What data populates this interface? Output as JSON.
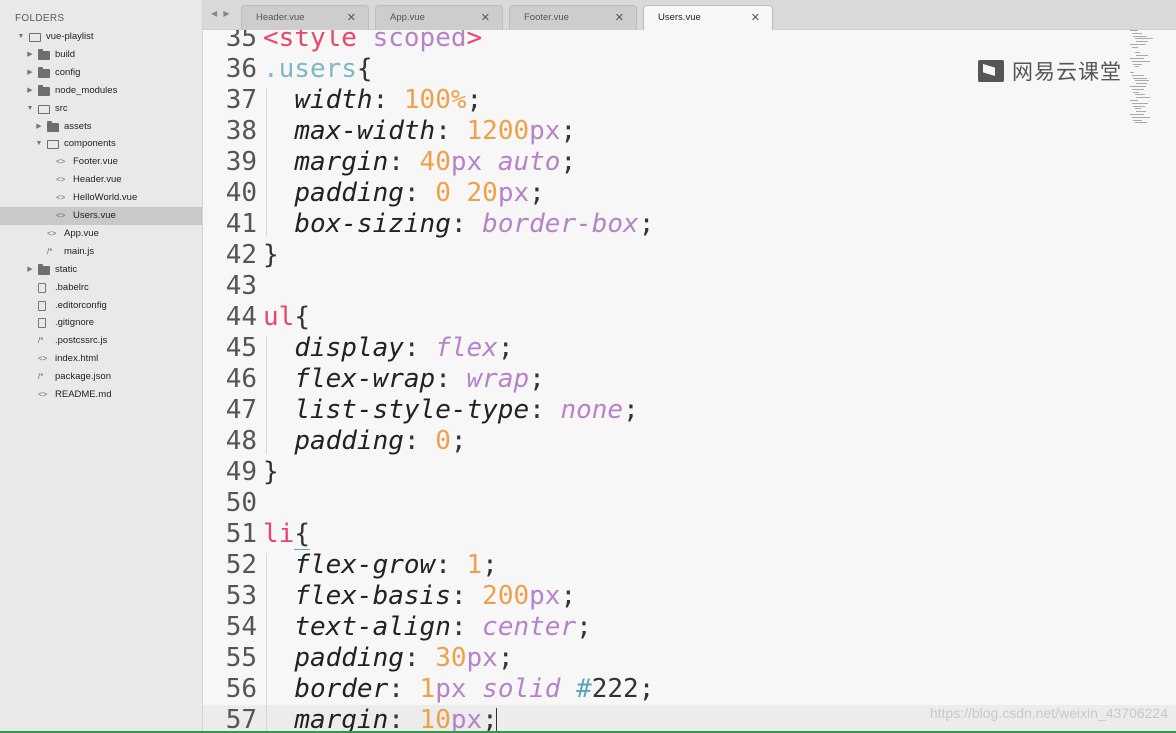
{
  "sidebar": {
    "header": "FOLDERS",
    "items": [
      {
        "label": "vue-playlist",
        "kind": "folder-open",
        "arrow": "▼"
      },
      {
        "label": "build",
        "kind": "folder",
        "arrow": "▶"
      },
      {
        "label": "config",
        "kind": "folder",
        "arrow": "▶"
      },
      {
        "label": "node_modules",
        "kind": "folder",
        "arrow": "▶"
      },
      {
        "label": "src",
        "kind": "folder-open",
        "arrow": "▼"
      },
      {
        "label": "assets",
        "kind": "folder",
        "arrow": "▶"
      },
      {
        "label": "components",
        "kind": "folder-open",
        "arrow": "▼"
      },
      {
        "label": "Footer.vue",
        "kind": "code",
        "icon": "<>"
      },
      {
        "label": "Header.vue",
        "kind": "code",
        "icon": "<>"
      },
      {
        "label": "HelloWorld.vue",
        "kind": "code",
        "icon": "<>"
      },
      {
        "label": "Users.vue",
        "kind": "code",
        "icon": "<>",
        "selected": true
      },
      {
        "label": "App.vue",
        "kind": "code",
        "icon": "<>"
      },
      {
        "label": "main.js",
        "kind": "js",
        "icon": "/*"
      },
      {
        "label": "static",
        "kind": "folder",
        "arrow": "▶"
      },
      {
        "label": ".babelrc",
        "kind": "file"
      },
      {
        "label": ".editorconfig",
        "kind": "file"
      },
      {
        "label": ".gitignore",
        "kind": "file"
      },
      {
        "label": ".postcssrc.js",
        "kind": "js",
        "icon": "/*"
      },
      {
        "label": "index.html",
        "kind": "code",
        "icon": "<>"
      },
      {
        "label": "package.json",
        "kind": "js",
        "icon": "/*"
      },
      {
        "label": "README.md",
        "kind": "code",
        "icon": "<>"
      }
    ]
  },
  "tabs": {
    "nav": "◀ ▶",
    "items": [
      {
        "label": "Header.vue",
        "close": "✕",
        "active": false
      },
      {
        "label": "App.vue",
        "close": "✕",
        "active": false
      },
      {
        "label": "Footer.vue",
        "close": "✕",
        "active": false
      },
      {
        "label": "Users.vue",
        "close": "✕",
        "active": true
      }
    ]
  },
  "editor": {
    "current_line": 57,
    "lines": [
      {
        "n": "35",
        "tokens": [
          [
            "t-tag",
            "<style "
          ],
          [
            "t-attr",
            "scoped"
          ],
          [
            "t-tag",
            ">"
          ]
        ]
      },
      {
        "n": "36",
        "tokens": [
          [
            "t-sel",
            ".users"
          ],
          [
            "t-brace",
            "{"
          ]
        ]
      },
      {
        "n": "37",
        "tokens": [
          [
            "t-str",
            "  "
          ],
          [
            "t-prop",
            "width"
          ],
          [
            "t-punc",
            ": "
          ],
          [
            "t-num",
            "100%"
          ],
          [
            "t-punc",
            ";"
          ]
        ]
      },
      {
        "n": "38",
        "tokens": [
          [
            "t-str",
            "  "
          ],
          [
            "t-prop",
            "max-width"
          ],
          [
            "t-punc",
            ": "
          ],
          [
            "t-num",
            "1200"
          ],
          [
            "t-unit",
            "px"
          ],
          [
            "t-punc",
            ";"
          ]
        ]
      },
      {
        "n": "39",
        "tokens": [
          [
            "t-str",
            "  "
          ],
          [
            "t-prop",
            "margin"
          ],
          [
            "t-punc",
            ": "
          ],
          [
            "t-num",
            "40"
          ],
          [
            "t-unit",
            "px "
          ],
          [
            "t-kw",
            "auto"
          ],
          [
            "t-punc",
            ";"
          ]
        ]
      },
      {
        "n": "40",
        "tokens": [
          [
            "t-str",
            "  "
          ],
          [
            "t-prop",
            "padding"
          ],
          [
            "t-punc",
            ": "
          ],
          [
            "t-num",
            "0 20"
          ],
          [
            "t-unit",
            "px"
          ],
          [
            "t-punc",
            ";"
          ]
        ]
      },
      {
        "n": "41",
        "tokens": [
          [
            "t-str",
            "  "
          ],
          [
            "t-prop",
            "box-sizing"
          ],
          [
            "t-punc",
            ": "
          ],
          [
            "t-kw",
            "border-box"
          ],
          [
            "t-punc",
            ";"
          ]
        ]
      },
      {
        "n": "42",
        "tokens": [
          [
            "t-brace",
            "}"
          ]
        ]
      },
      {
        "n": "43",
        "tokens": []
      },
      {
        "n": "44",
        "tokens": [
          [
            "t-selred",
            "ul"
          ],
          [
            "t-brace",
            "{"
          ]
        ]
      },
      {
        "n": "45",
        "tokens": [
          [
            "t-str",
            "  "
          ],
          [
            "t-prop",
            "display"
          ],
          [
            "t-punc",
            ": "
          ],
          [
            "t-kw",
            "flex"
          ],
          [
            "t-punc",
            ";"
          ]
        ]
      },
      {
        "n": "46",
        "tokens": [
          [
            "t-str",
            "  "
          ],
          [
            "t-prop",
            "flex-wrap"
          ],
          [
            "t-punc",
            ": "
          ],
          [
            "t-kw",
            "wrap"
          ],
          [
            "t-punc",
            ";"
          ]
        ]
      },
      {
        "n": "47",
        "tokens": [
          [
            "t-str",
            "  "
          ],
          [
            "t-prop",
            "list-style-type"
          ],
          [
            "t-punc",
            ": "
          ],
          [
            "t-kw",
            "none"
          ],
          [
            "t-punc",
            ";"
          ]
        ]
      },
      {
        "n": "48",
        "tokens": [
          [
            "t-str",
            "  "
          ],
          [
            "t-prop",
            "padding"
          ],
          [
            "t-punc",
            ": "
          ],
          [
            "t-num",
            "0"
          ],
          [
            "t-punc",
            ";"
          ]
        ]
      },
      {
        "n": "49",
        "tokens": [
          [
            "t-brace",
            "}"
          ]
        ]
      },
      {
        "n": "50",
        "tokens": []
      },
      {
        "n": "51",
        "tokens": [
          [
            "t-selred",
            "li"
          ],
          [
            "t-brace",
            "{"
          ]
        ]
      },
      {
        "n": "52",
        "tokens": [
          [
            "t-str",
            "  "
          ],
          [
            "t-prop",
            "flex-grow"
          ],
          [
            "t-punc",
            ": "
          ],
          [
            "t-num",
            "1"
          ],
          [
            "t-punc",
            ";"
          ]
        ]
      },
      {
        "n": "53",
        "tokens": [
          [
            "t-str",
            "  "
          ],
          [
            "t-prop",
            "flex-basis"
          ],
          [
            "t-punc",
            ": "
          ],
          [
            "t-num",
            "200"
          ],
          [
            "t-unit",
            "px"
          ],
          [
            "t-punc",
            ";"
          ]
        ]
      },
      {
        "n": "54",
        "tokens": [
          [
            "t-str",
            "  "
          ],
          [
            "t-prop",
            "text-align"
          ],
          [
            "t-punc",
            ": "
          ],
          [
            "t-kw",
            "center"
          ],
          [
            "t-punc",
            ";"
          ]
        ]
      },
      {
        "n": "55",
        "tokens": [
          [
            "t-str",
            "  "
          ],
          [
            "t-prop",
            "padding"
          ],
          [
            "t-punc",
            ": "
          ],
          [
            "t-num",
            "30"
          ],
          [
            "t-unit",
            "px"
          ],
          [
            "t-punc",
            ";"
          ]
        ]
      },
      {
        "n": "56",
        "tokens": [
          [
            "t-str",
            "  "
          ],
          [
            "t-prop",
            "border"
          ],
          [
            "t-punc",
            ": "
          ],
          [
            "t-num",
            "1"
          ],
          [
            "t-unit",
            "px "
          ],
          [
            "t-kw",
            "solid "
          ],
          [
            "t-hash",
            "#"
          ],
          [
            "t-str",
            "222"
          ],
          [
            "t-punc",
            ";"
          ]
        ]
      },
      {
        "n": "57",
        "tokens": [
          [
            "t-str",
            "  "
          ],
          [
            "t-prop",
            "margin"
          ],
          [
            "t-punc",
            ": "
          ],
          [
            "t-num",
            "10"
          ],
          [
            "t-unit",
            "px"
          ],
          [
            "t-punc",
            ";"
          ]
        ]
      }
    ]
  },
  "watermark": {
    "logo_text": "网易云课堂",
    "url": "https://blog.csdn.net/weixin_43706224"
  },
  "colors": {
    "tag": "#e8466c",
    "attribute": "#b882c9",
    "number": "#f0a04a",
    "class_selector": "#7fb6c8",
    "accent_bar": "#2f9a4a"
  }
}
